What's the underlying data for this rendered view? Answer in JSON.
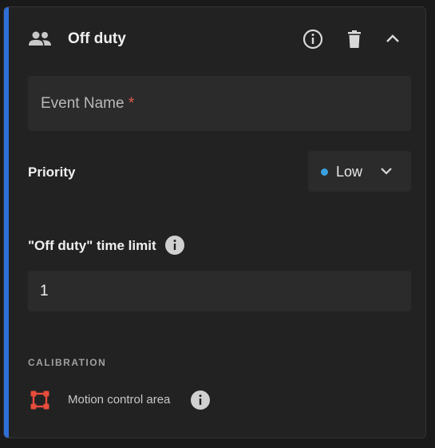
{
  "header": {
    "title": "Off duty",
    "icons": {
      "group": "group-icon",
      "info": "info-icon",
      "delete": "trash-icon",
      "collapse": "chevron-up-icon"
    }
  },
  "event_name": {
    "placeholder": "Event Name",
    "required_mark": "*",
    "value": ""
  },
  "priority": {
    "label": "Priority",
    "selected": "Low",
    "dot_color": "#3aa0e0"
  },
  "time_limit": {
    "label": "\"Off duty\" time limit",
    "value": "1"
  },
  "calibration": {
    "section_title": "CALIBRATION",
    "item_label": "Motion control area",
    "icon_color": "#e74c3c"
  },
  "colors": {
    "accent": "#2f6fd8",
    "required": "#e25a4f"
  }
}
